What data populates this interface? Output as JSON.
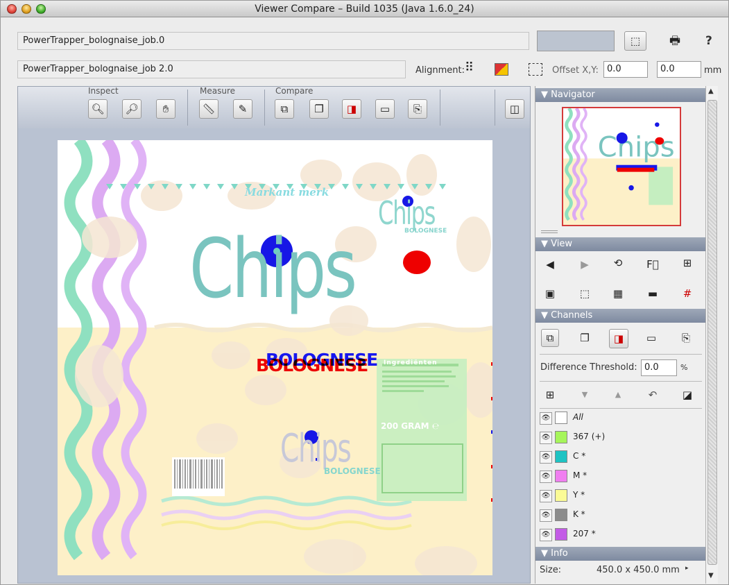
{
  "window": {
    "title": "Viewer Compare – Build 1035 (Java 1.6.0_24)"
  },
  "files": {
    "file1": "PowerTrapper_bolognaise_job.0",
    "file2": "PowerTrapper_bolognaise_job 2.0"
  },
  "header": {
    "alignment_label": "Alignment:",
    "offset_label": "Offset X,Y:",
    "offset_x": "0.0",
    "offset_y": "0.0",
    "unit": "mm",
    "help": "?"
  },
  "toolbar": {
    "inspect": "Inspect",
    "measure": "Measure",
    "compare": "Compare"
  },
  "document": {
    "brand": "Markant merk",
    "title_big": "Chips",
    "subtitle": "BOLOGNESE",
    "title_small": "Chips",
    "weight": "200 GRAM ℮",
    "ingredients_head": "Ingrediënten",
    "overlay_blue": "BOLOGNESE",
    "overlay_red": "BOLOGNESE"
  },
  "navigator": {
    "label": "Navigator"
  },
  "view": {
    "label": "View"
  },
  "channels": {
    "label": "Channels",
    "threshold_label": "Difference Threshold:",
    "threshold_value": "0.0",
    "threshold_unit": "%",
    "items": [
      {
        "label": "All",
        "color": "#ffffff"
      },
      {
        "label": "367 (+)",
        "color": "#a6f55a"
      },
      {
        "label": "C *",
        "color": "#1ec3c3"
      },
      {
        "label": "M *",
        "color": "#f07ef0"
      },
      {
        "label": "Y *",
        "color": "#fbfb96"
      },
      {
        "label": "K *",
        "color": "#8c8c8c"
      },
      {
        "label": "207 *",
        "color": "#c35be6"
      }
    ]
  },
  "info": {
    "label": "Info",
    "size_label": "Size:",
    "size_value": "450.0 x 450.0 mm"
  }
}
